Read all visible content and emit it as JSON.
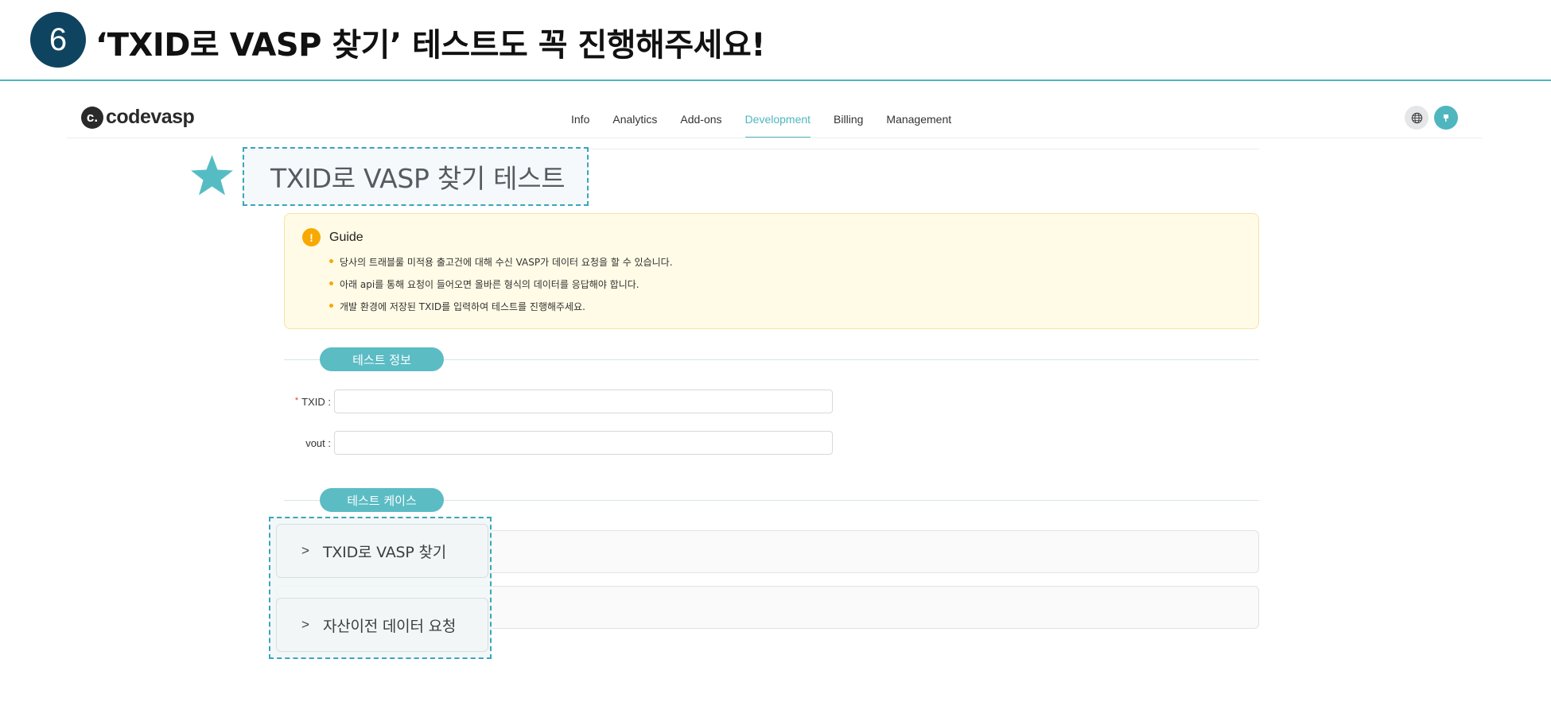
{
  "slide": {
    "step_number": "6",
    "title": "‘TXID로 VASP 찾기’ 테스트도 꼭 진행해주세요!"
  },
  "app": {
    "logo_mark": "c.",
    "logo_text": "codevasp",
    "nav": [
      {
        "label": "Info",
        "active": false
      },
      {
        "label": "Analytics",
        "active": false
      },
      {
        "label": "Add-ons",
        "active": false
      },
      {
        "label": "Development",
        "active": true
      },
      {
        "label": "Billing",
        "active": false
      },
      {
        "label": "Management",
        "active": false
      }
    ],
    "avatar_icon": "user-flag-icon",
    "globe_icon": "globe-icon"
  },
  "page": {
    "title": "TXID로 VASP 찾기 테스트"
  },
  "guide": {
    "icon": "!",
    "title": "Guide",
    "items": [
      "당사의 트래블룰 미적용 출고건에 대해 수신 VASP가 데이터 요청을 할 수 있습니다.",
      "아래 api를 통해 요청이 들어오면 올바른 형식의 데이터를 응답해야 합니다.",
      "개발 환경에 저장된 TXID를 입력하여 테스트를 진행해주세요."
    ]
  },
  "test_info": {
    "section_label": "테스트 정보",
    "txid_label": "TXID :",
    "txid_required": "*",
    "txid_value": "",
    "vout_label": "vout :",
    "vout_value": ""
  },
  "test_cases": {
    "section_label": "테스트 케이스",
    "items": [
      {
        "chevron": ">",
        "label": "TXID로 VASP 찾기"
      },
      {
        "chevron": ">",
        "label": "자산이전 데이터 요청"
      }
    ]
  },
  "colors": {
    "accent": "#4fb6bf",
    "badge": "#0f4460",
    "guide_bg": "#fffbe6",
    "warning": "#f7a900"
  }
}
